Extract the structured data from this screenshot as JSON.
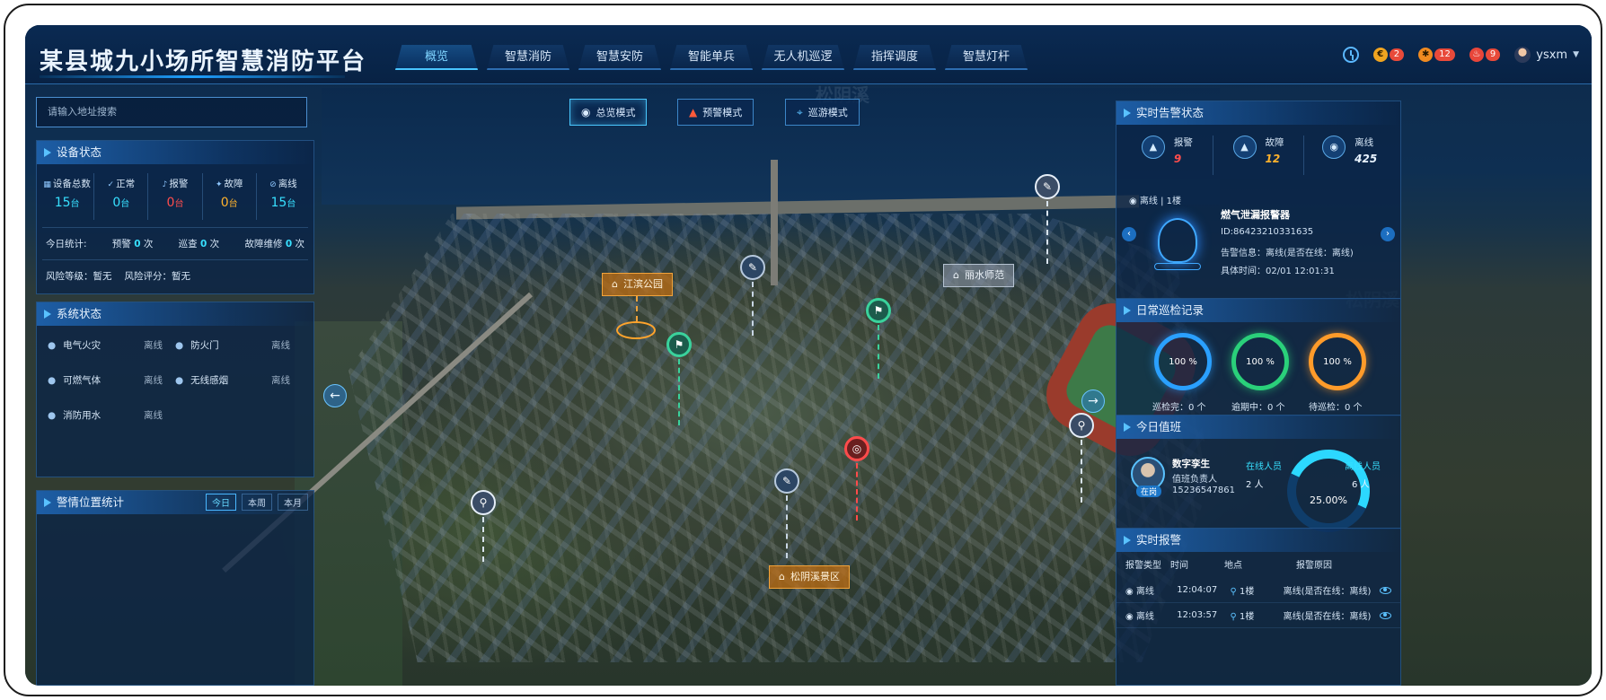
{
  "app": {
    "title": "某县城九小场所智慧消防平台"
  },
  "nav": {
    "items": [
      "概览",
      "智慧消防",
      "智慧安防",
      "智能单兵",
      "无人机巡逻",
      "指挥调度",
      "智慧灯杆"
    ],
    "active_index": 0
  },
  "header_right": {
    "badges": [
      {
        "icon": "coin-icon",
        "count": "2"
      },
      {
        "icon": "gear-alert-icon",
        "count": "12"
      },
      {
        "icon": "alarm-icon",
        "count": "9"
      }
    ],
    "user": "ysxm"
  },
  "search": {
    "placeholder": "请输入地址搜索"
  },
  "mode_buttons": [
    {
      "label": "总览模式",
      "icon": "eye-icon",
      "active": true
    },
    {
      "label": "预警模式",
      "icon": "siren-icon",
      "active": false
    },
    {
      "label": "巡游模式",
      "icon": "location-icon",
      "active": false
    }
  ],
  "device_status": {
    "title": "设备状态",
    "cells": [
      {
        "label": "设备总数",
        "value": "15",
        "unit": "台",
        "color": "#37e0ff"
      },
      {
        "label": "正常",
        "value": "0",
        "unit": "台",
        "color": "#37e0ff"
      },
      {
        "label": "报警",
        "value": "0",
        "unit": "台",
        "color": "#ff4d4d"
      },
      {
        "label": "故障",
        "value": "0",
        "unit": "台",
        "color": "#ffb22c"
      },
      {
        "label": "离线",
        "value": "15",
        "unit": "台",
        "color": "#37e0ff"
      }
    ],
    "today_label": "今日统计:",
    "today": [
      {
        "label": "预警",
        "value": "0",
        "unit": "次"
      },
      {
        "label": "巡查",
        "value": "0",
        "unit": "次"
      },
      {
        "label": "故障维修",
        "value": "0",
        "unit": "次"
      }
    ],
    "risk_level": "风险等级：暂无",
    "risk_score": "风险评分：暂无"
  },
  "system_status": {
    "title": "系统状态",
    "items": [
      {
        "name": "电气火灾",
        "status": "离线"
      },
      {
        "name": "防火门",
        "status": "离线"
      },
      {
        "name": "可燃气体",
        "status": "离线"
      },
      {
        "name": "无线感烟",
        "status": "离线"
      },
      {
        "name": "消防用水",
        "status": "离线"
      }
    ]
  },
  "alarm_location": {
    "title": "警情位置统计",
    "tabs": [
      "今日",
      "本周",
      "本月"
    ],
    "active_tab": 0
  },
  "map_labels": {
    "park": "江滨公园",
    "school": "丽水师范",
    "scenic": "松阴溪景区",
    "watermark": "松阴溪"
  },
  "realtime_alert_status": {
    "title": "实时告警状态",
    "cells": [
      {
        "label": "报警",
        "value": "9",
        "color": "#ff4d4d"
      },
      {
        "label": "故障",
        "value": "12",
        "color": "#ffb22c"
      },
      {
        "label": "离线",
        "value": "425",
        "color": "#e8f3ff"
      }
    ],
    "card": {
      "status": "离线",
      "floor": "1楼",
      "device": "燃气泄漏报警器",
      "id": "ID:86423210331635",
      "info": "告警信息：离线(是否在线：离线)",
      "time": "具体时间：02/01 12:01:31"
    }
  },
  "inspection": {
    "title": "日常巡检记录",
    "rings": [
      {
        "pct": "100 %",
        "caption": "巡检完：0 个"
      },
      {
        "pct": "100 %",
        "caption": "逾期中：0 个"
      },
      {
        "pct": "100 %",
        "caption": "待巡检：0 个"
      }
    ]
  },
  "duty": {
    "title": "今日值班",
    "name": "数字孪生",
    "role": "值班负责人",
    "phone": "15236547861",
    "tag": "在岗",
    "online_label": "在线人员",
    "online_count": "2 人",
    "offline_label": "离线人员",
    "offline_count": "6 人",
    "rate": "25.00%"
  },
  "realtime_alarms": {
    "title": "实时报警",
    "columns": [
      "报警类型",
      "时间",
      "地点",
      "报警原因"
    ],
    "rows": [
      {
        "type": "离线",
        "time": "12:04:07",
        "place": "1楼",
        "reason": "离线(是否在线：离线)"
      },
      {
        "type": "离线",
        "time": "12:03:57",
        "place": "1楼",
        "reason": "离线(是否在线：离线)"
      }
    ]
  }
}
